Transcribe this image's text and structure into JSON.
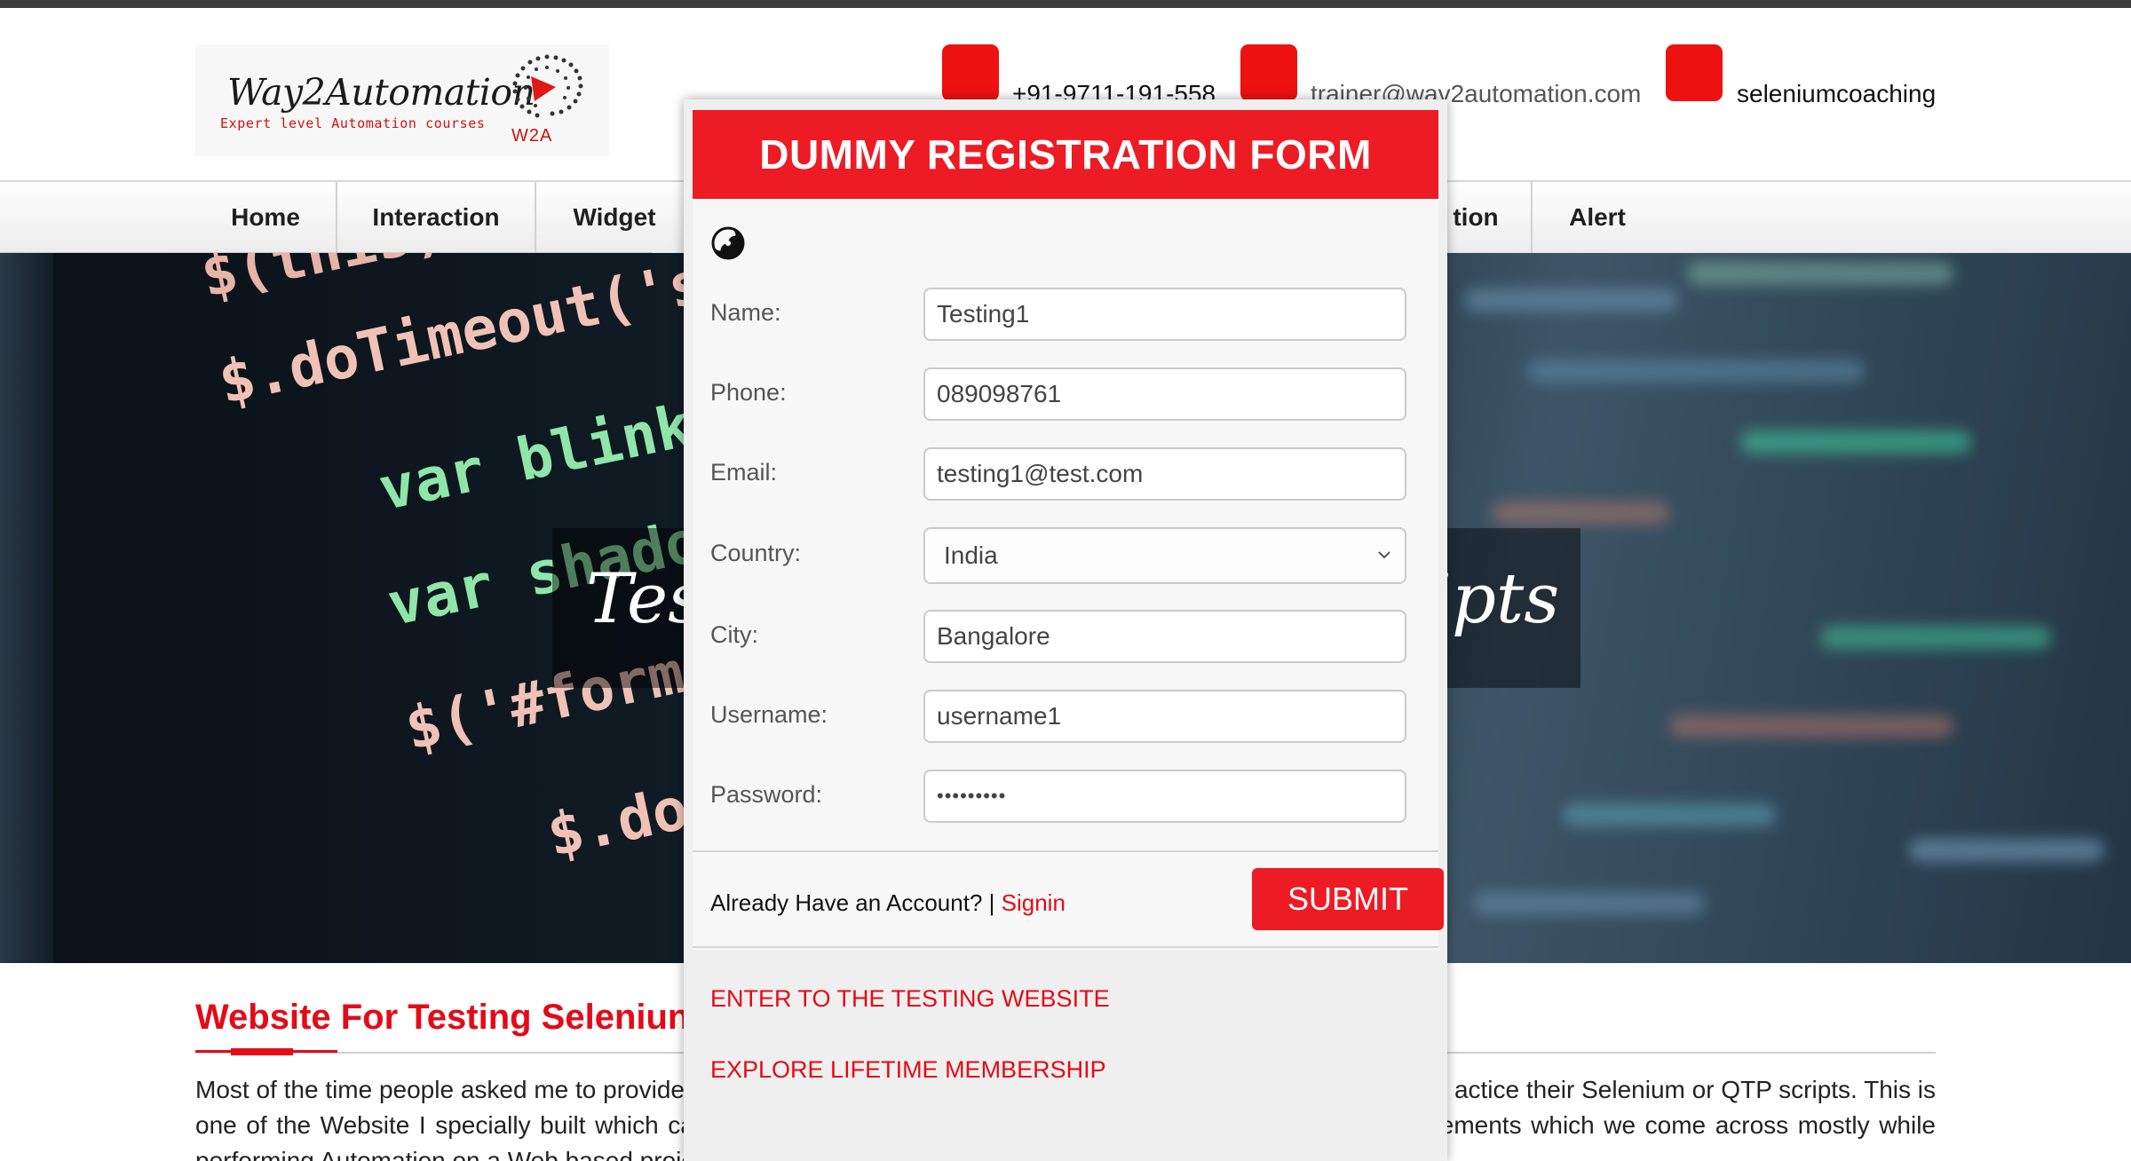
{
  "header": {
    "logo": {
      "name": "Way2Automation",
      "tagline": "Expert level Automation courses",
      "mark": "W2A"
    },
    "contacts": [
      {
        "icon": "phone-icon",
        "text": "+91-9711-191-558"
      },
      {
        "icon": "email-icon",
        "text": "trainer@wav2automation.com"
      },
      {
        "icon": "skype-icon",
        "text": "seleniumcoaching"
      }
    ],
    "accent_color": "#ee1111"
  },
  "nav": {
    "items": [
      "Home",
      "Interaction",
      "Widget",
      "",
      "",
      "",
      "",
      "tion",
      "Alert"
    ]
  },
  "hero": {
    "caption_left": "Tes",
    "caption_right": "ipts",
    "code_lines": [
      "$(this)",
      "$.doTimeout('sc",
      "var blinkSp",
      "var shadow",
      "$('#form",
      "$.doT"
    ]
  },
  "content": {
    "title": "Website For Testing Seleniun",
    "paragraph": "Most of the time people asked me to provide a website where they can practice their Selenium or QTP scripts. This is one of the Website I specially built which can fulfill the basic requirement of testing the simple and complex elements which we come across mostly while performing Automation on a Web based project.",
    "paragraph_visible_left": "Most of the time people asked me to provide",
    "paragraph_visible_right": "actice their Selenium or QTP scripts. This is",
    "line2_left": "one of the Website I specially built which can fulfill the basic requirement of testing the simple and complex elements which we come across mostly while",
    "line3": "performing Automation on a Web based project."
  },
  "modal": {
    "title": "DUMMY REGISTRATION FORM",
    "fields": [
      {
        "label": "Name:",
        "value": "Testing1",
        "type": "text"
      },
      {
        "label": "Phone:",
        "value": "089098761",
        "type": "text"
      },
      {
        "label": "Email:",
        "value": "testing1@test.com",
        "type": "text"
      },
      {
        "label": "Country:",
        "value": "India",
        "type": "select"
      },
      {
        "label": "City:",
        "value": "Bangalore",
        "type": "text"
      },
      {
        "label": "Username:",
        "value": "username1",
        "type": "text"
      },
      {
        "label": "Password:",
        "value": "•••••••••",
        "type": "password"
      }
    ],
    "already_account": "Already Have an Account? | ",
    "signin": "Signin",
    "submit": "SUBMIT",
    "links": [
      "ENTER TO THE TESTING WEBSITE",
      "EXPLORE LIFETIME MEMBERSHIP"
    ],
    "header_color": "#ed1b24"
  }
}
